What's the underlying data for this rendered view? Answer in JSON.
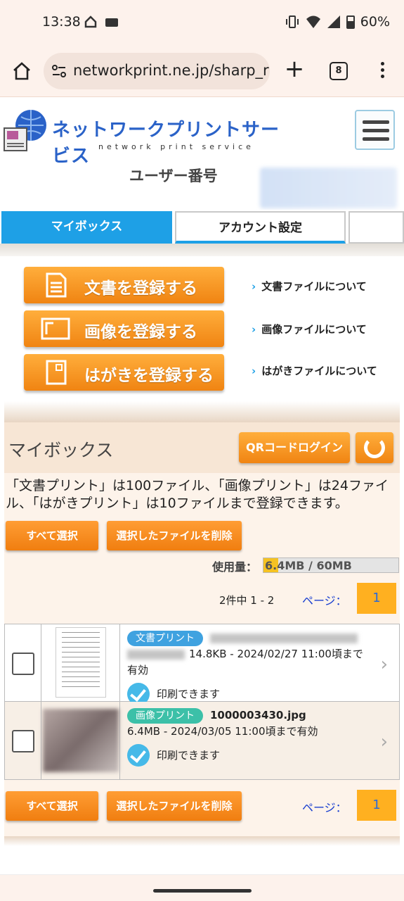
{
  "status_bar": {
    "time": "13:38",
    "battery": "60%"
  },
  "browser": {
    "url": "networkprint.ne.jp/sharp_r",
    "tab_count": "8"
  },
  "site": {
    "logo_title": "ネットワークプリントサービス",
    "logo_subtitle": "network print service",
    "user_label": "ユーザー番号"
  },
  "tabs": {
    "mybox": "マイボックス",
    "account": "アカウント設定"
  },
  "register": {
    "document_button": "文書を登録する",
    "image_button": "画像を登録する",
    "postcard_button": "はがきを登録する",
    "document_link": "文書ファイルについて",
    "image_link": "画像ファイルについて",
    "postcard_link": "はがきファイルについて"
  },
  "mybox": {
    "title": "マイボックス",
    "qr_login": "QRコードログイン",
    "notice": "「文書プリント」は100ファイル、「画像プリント」は24ファイル、「はがきプリント」は10ファイルまで登録できます。",
    "select_all": "すべて選択",
    "delete_selected": "選択したファイルを削除",
    "usage_label": "使用量：",
    "usage_text": "6.4MB / 60MB",
    "usage_fraction": 0.107,
    "count_text": "2件中 1 - 2",
    "page_label": "ページ：",
    "page_number": "1"
  },
  "files": [
    {
      "type_label": "文書プリント",
      "meta": "14.8KB - 2024/02/27 11:00頃まで有効",
      "status": "印刷できます"
    },
    {
      "type_label": "画像プリント",
      "name": "1000003430.jpg",
      "meta": "6.4MB - 2024/03/05 11:00頃まで有効",
      "status": "印刷できます"
    }
  ],
  "colors": {
    "orange": "#f08412",
    "blue_tab": "#1ea0e6",
    "panel_bg": "#fdf3ea"
  }
}
